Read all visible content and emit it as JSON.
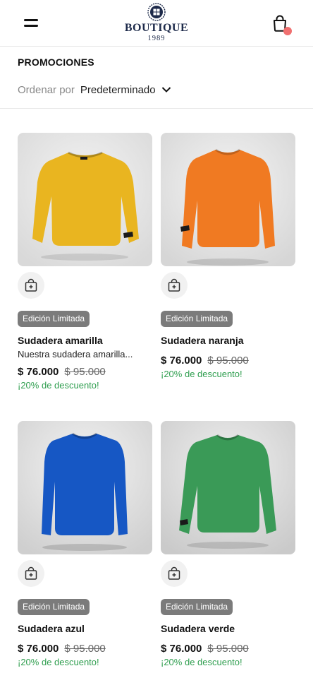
{
  "header": {
    "brand_name": "BOUTIQUE",
    "brand_year": "1989",
    "icons": {
      "menu": "hamburger-menu-icon",
      "cart": "shopping-bag-icon"
    },
    "cart_badge_color": "#f07070"
  },
  "section": {
    "title": "PROMOCIONES",
    "sort_label": "Ordenar por",
    "sort_value": "Predeterminado"
  },
  "colors": {
    "badge_bg": "#7b7b7b",
    "discount_text": "#2f9e4f"
  },
  "products": [
    {
      "badge": "Edición Limitada",
      "name": "Sudadera amarilla",
      "description": "Nuestra sudadera amarilla...",
      "price": "$ 76.000",
      "old_price": "$ 95.000",
      "discount": "¡20% de descuento!",
      "color": "#e9b520"
    },
    {
      "badge": "Edición Limitada",
      "name": "Sudadera naranja",
      "description": "",
      "price": "$ 76.000",
      "old_price": "$ 95.000",
      "discount": "¡20% de descuento!",
      "color": "#f07a22"
    },
    {
      "badge": "Edición Limitada",
      "name": "Sudadera azul",
      "description": "",
      "price": "$ 76.000",
      "old_price": "$ 95.000",
      "discount": "¡20% de descuento!",
      "color": "#1657c4"
    },
    {
      "badge": "Edición Limitada",
      "name": "Sudadera verde",
      "description": "",
      "price": "$ 76.000",
      "old_price": "$ 95.000",
      "discount": "¡20% de descuento!",
      "color": "#3a9a57"
    }
  ]
}
